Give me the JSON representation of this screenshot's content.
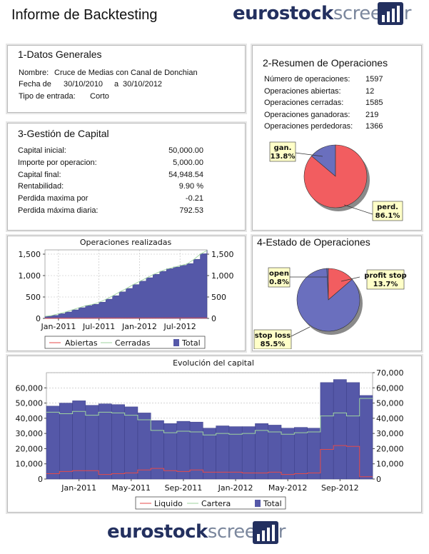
{
  "header": {
    "title": "Informe de Backtesting",
    "logo_part1": "eurostock",
    "logo_part2": "screener"
  },
  "datos_generales": {
    "title": "1-Datos Generales",
    "nombre_label": "Nombre:",
    "nombre_value": "Cruce de Medias con Canal de Donchian",
    "fecha_label": "Fecha de",
    "fecha_desde": "30/10/2010",
    "fecha_a": "a",
    "fecha_hasta": "30/10/2012",
    "tipo_label": "Tipo de entrada:",
    "tipo_value": "Corto"
  },
  "resumen": {
    "title": "2-Resumen de Operaciones",
    "rows": [
      {
        "label": "Número de operaciones:",
        "value": "1597"
      },
      {
        "label": "Operaciones abiertas:",
        "value": "12"
      },
      {
        "label": "Operaciones cerradas:",
        "value": "1585"
      },
      {
        "label": "Operaciones ganadoras:",
        "value": "219"
      },
      {
        "label": "Operaciones perdedoras:",
        "value": "1366"
      }
    ]
  },
  "gestion": {
    "title": "3-Gestión de Capital",
    "rows": [
      {
        "label": "Capital inicial:",
        "value": "50,000.00"
      },
      {
        "label": "Importe por operacion:",
        "value": "5,000.00"
      },
      {
        "label": "Capital final:",
        "value": "54,948.54"
      },
      {
        "label": "Rentabilidad:",
        "value": "9.90 %"
      },
      {
        "label": "Perdida maxima por",
        "value": "-0.21"
      },
      {
        "label": "Perdida máxima diaria:",
        "value": "792.53"
      }
    ]
  },
  "estado": {
    "title": "4-Estado de Operaciones"
  },
  "colors": {
    "navy": "#5558a8",
    "pie_red": "#f25d60",
    "pie_blue": "#6a6fbe",
    "label_bg": "#ffffc8",
    "red_line": "#e44a4a",
    "green_line": "#9ed39e",
    "logo_dark": "#23305f",
    "logo_light": "#7b879d"
  },
  "chart_data": [
    {
      "type": "pie",
      "name": "resultado",
      "labels": [
        "gan.\n13.8%",
        "perd.\n86.1%"
      ],
      "values": [
        13.8,
        86.1
      ],
      "colors": [
        "#6a6fbe",
        "#f25d60"
      ]
    },
    {
      "type": "area",
      "title": "Operaciones realizadas",
      "x_ticks": [
        "Jan-2011",
        "Jul-2011",
        "Jan-2012",
        "Jul-2012"
      ],
      "y_ticks": [
        "0",
        "500",
        "1,000",
        "1,500"
      ],
      "ylim": [
        0,
        1600
      ],
      "legend": [
        "Abiertas",
        "Cerradas",
        "Total"
      ],
      "x_months": [
        0,
        1,
        2,
        3,
        4,
        5,
        6,
        7,
        8,
        9,
        10,
        11,
        12,
        13,
        14,
        15,
        16,
        17,
        18,
        19,
        20,
        21,
        22,
        23,
        24
      ],
      "series": [
        {
          "name": "Total",
          "values": [
            50,
            70,
            110,
            150,
            200,
            250,
            300,
            330,
            380,
            450,
            530,
            620,
            700,
            790,
            870,
            950,
            1030,
            1100,
            1160,
            1200,
            1240,
            1280,
            1380,
            1510,
            1597
          ]
        },
        {
          "name": "Cerradas",
          "values": [
            48,
            68,
            107,
            147,
            196,
            246,
            295,
            325,
            375,
            444,
            524,
            613,
            693,
            782,
            862,
            941,
            1021,
            1090,
            1150,
            1190,
            1230,
            1269,
            1369,
            1499,
            1585
          ]
        },
        {
          "name": "Abiertas",
          "values": [
            2,
            3,
            4,
            4,
            5,
            5,
            6,
            6,
            7,
            7,
            8,
            8,
            9,
            9,
            9,
            10,
            10,
            10,
            11,
            11,
            11,
            12,
            12,
            12,
            12
          ]
        }
      ]
    },
    {
      "type": "pie",
      "name": "estado",
      "labels": [
        "open\n0.8%",
        "profit stop\n13.7%",
        "stop loss\n85.5%"
      ],
      "values": [
        0.8,
        13.7,
        85.5
      ],
      "colors": [
        "#6a6fbe",
        "#f25d60",
        "#6a6fbe"
      ]
    },
    {
      "type": "bar",
      "title": "Evolución del capital",
      "x_ticks": [
        "Jan-2011",
        "May-2011",
        "Sep-2011",
        "Jan-2012",
        "May-2012",
        "Sep-2012"
      ],
      "y_left_ticks": [
        "0",
        "10,000",
        "20,000",
        "30,000",
        "40,000",
        "50,000",
        "60,000"
      ],
      "y_right_ticks": [
        "0",
        "10,000",
        "20,000",
        "30,000",
        "40,000",
        "50,000",
        "60,000",
        "70,000"
      ],
      "ylim": [
        0,
        70000
      ],
      "legend": [
        "Liquido",
        "Cartera",
        "Total"
      ],
      "series": [
        {
          "name": "Total",
          "values": [
            48000,
            50000,
            51500,
            48500,
            49500,
            49000,
            47500,
            43500,
            38500,
            36500,
            38000,
            37500,
            33500,
            35000,
            34500,
            34500,
            36500,
            35500,
            33500,
            34000,
            33500,
            63500,
            65500,
            63500,
            55000
          ]
        },
        {
          "name": "Cartera",
          "values": [
            44000,
            43000,
            44500,
            42000,
            44000,
            43500,
            42000,
            39000,
            32000,
            30500,
            31500,
            31000,
            29000,
            30000,
            29500,
            30000,
            32000,
            31000,
            29500,
            30500,
            31000,
            41500,
            43500,
            41500,
            53000
          ]
        },
        {
          "name": "Liquido",
          "values": [
            3500,
            5000,
            5500,
            5500,
            3000,
            3500,
            4000,
            6000,
            7000,
            5500,
            5000,
            6000,
            4500,
            4500,
            4500,
            4000,
            4000,
            4500,
            3000,
            3500,
            4000,
            19500,
            22000,
            21500,
            1500
          ]
        }
      ]
    }
  ]
}
